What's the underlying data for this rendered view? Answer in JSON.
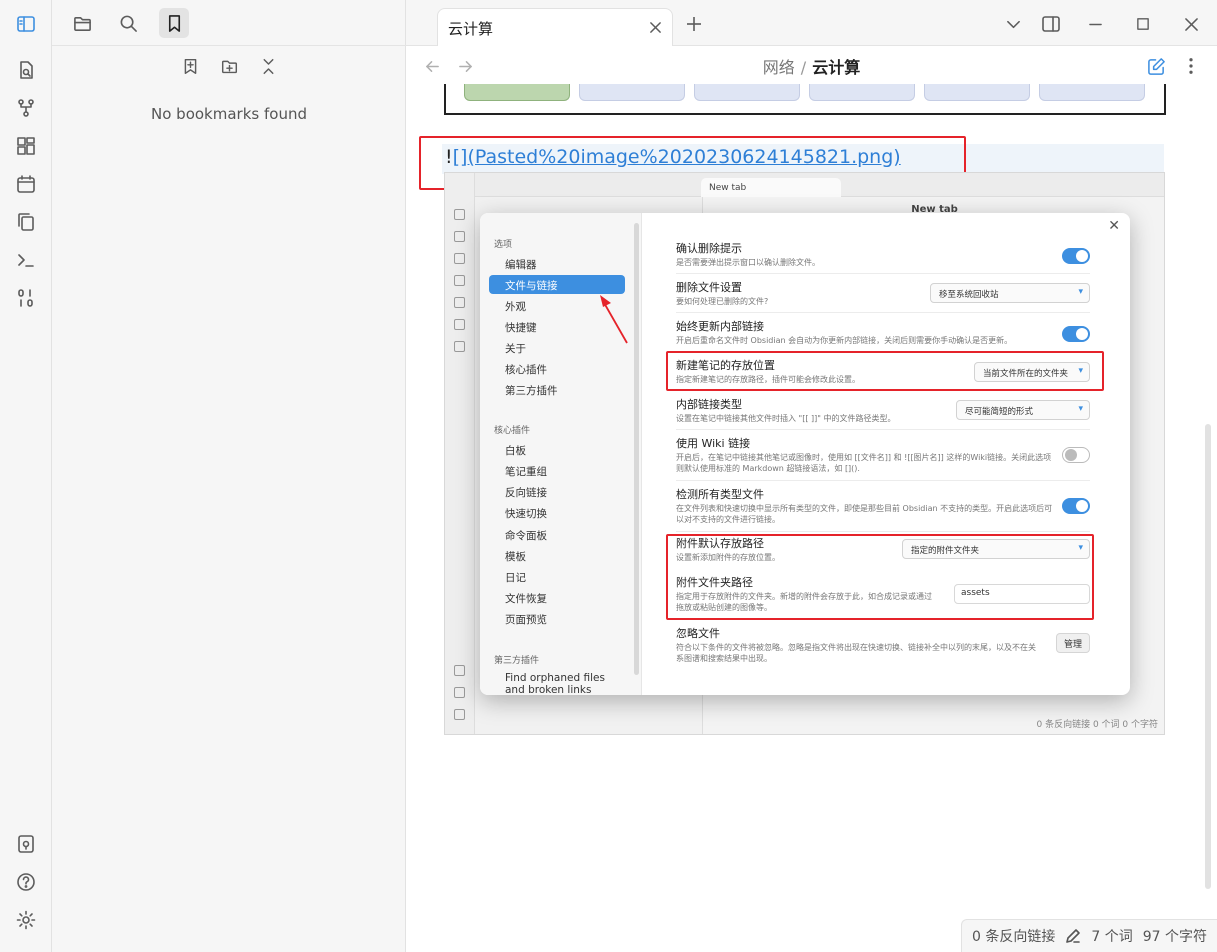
{
  "sidebar": {
    "empty_message": "No bookmarks found"
  },
  "tabs": [
    {
      "label": "云计算"
    }
  ],
  "breadcrumb": {
    "parent": "网络",
    "separator": "/",
    "current": "云计算"
  },
  "editor": {
    "markdown_prefix": "!",
    "markdown_link": "[](Pasted%20image%2020230624145821.png)"
  },
  "embedded_screenshot": {
    "tab_label": "New tab",
    "title": "New tab",
    "status": "0 条反向链接  0 个词  0 个字符",
    "dialog": {
      "nav_group_options": "选项",
      "nav_options": [
        "编辑器",
        "文件与链接",
        "外观",
        "快捷键",
        "关于",
        "核心插件",
        "第三方插件"
      ],
      "nav_group_core": "核心插件",
      "nav_core": [
        "白板",
        "笔记重组",
        "反向链接",
        "快速切换",
        "命令面板",
        "模板",
        "日记",
        "文件恢复",
        "页面预览"
      ],
      "nav_group_third": "第三方插件",
      "nav_third": [
        "Find orphaned files and broken links"
      ],
      "settings": [
        {
          "name": "确认删除提示",
          "desc": "是否需要弹出提示窗口以确认删除文件。",
          "control": "toggle-on"
        },
        {
          "name": "删除文件设置",
          "desc": "要如何处理已删除的文件?",
          "control": "dropdown",
          "value": "移至系统回收站"
        },
        {
          "name": "始终更新内部链接",
          "desc": "开启后重命名文件时 Obsidian 会自动为你更新内部链接，关闭后则需要你手动确认是否更新。",
          "control": "toggle-on"
        },
        {
          "name": "新建笔记的存放位置",
          "desc": "指定新建笔记的存放路径，插件可能会修改此设置。",
          "control": "dropdown",
          "value": "当前文件所在的文件夹"
        },
        {
          "name": "内部链接类型",
          "desc": "设置在笔记中链接其他文件时插入 \"[[ ]]\" 中的文件路径类型。",
          "control": "dropdown",
          "value": "尽可能简短的形式"
        },
        {
          "name": "使用 Wiki 链接",
          "desc": "开启后，在笔记中链接其他笔记或图像时，使用如 [[文件名]] 和 ![[图片名]] 这样的Wiki链接。关闭此选项则默认使用标准的 Markdown 超链接语法，如 [](). ",
          "control": "toggle-off"
        },
        {
          "name": "检测所有类型文件",
          "desc": "在文件列表和快速切换中显示所有类型的文件，即使是那些目前 Obsidian 不支持的类型。开启此选项后可以对不支持的文件进行链接。",
          "control": "toggle-on"
        },
        {
          "name": "附件默认存放路径",
          "desc": "设置新添加附件的存放位置。",
          "control": "dropdown",
          "value": "指定的附件文件夹"
        },
        {
          "name": "附件文件夹路径",
          "desc": "指定用于存放附件的文件夹。新增的附件会存放于此，如合成记录或通过拖放或粘贴创建的图像等。",
          "control": "input",
          "value": "assets"
        },
        {
          "name": "忽略文件",
          "desc": "符合以下条件的文件将被忽略。忽略是指文件将出现在快速切换、链接补全中以列的末尾，以及不在关系图谱和搜索结果中出现。",
          "control": "button",
          "value": "管理"
        }
      ]
    }
  },
  "statusbar": {
    "backlinks": "0 条反向链接",
    "words": "7 个词",
    "chars": "97 个字符"
  },
  "colors": {
    "accent": "#3d8fe0",
    "annotation_red": "#e5232a",
    "link": "#2e7fd6"
  }
}
